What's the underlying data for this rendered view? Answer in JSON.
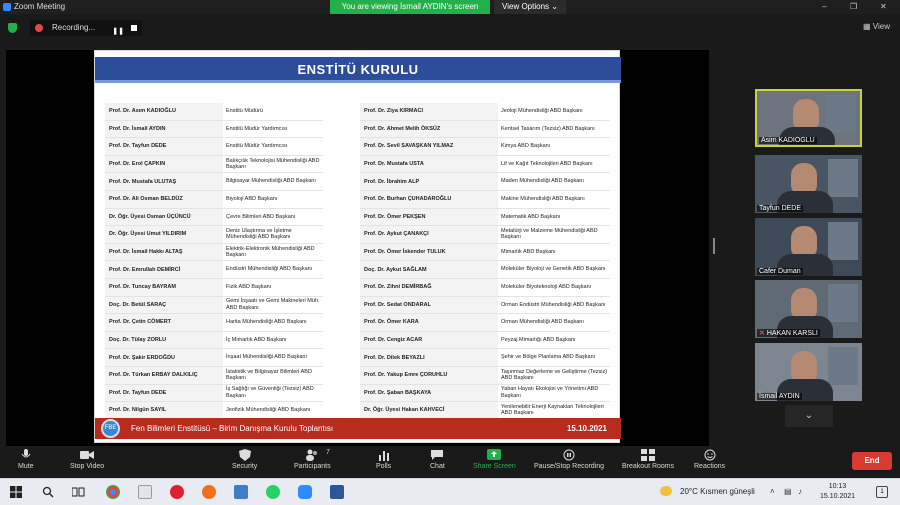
{
  "window": {
    "title": "Zoom Meeting",
    "banner": "You are viewing İsmail AYDIN's screen",
    "view_options": "View Options ⌄",
    "minimize": "–",
    "maximize": "❐",
    "close": "✕"
  },
  "status": {
    "recording_label": "Recording...",
    "pause": "❚❚",
    "view_label": "View"
  },
  "slide": {
    "title": "ENSTİTÜ KURULU",
    "left": [
      {
        "name": "Prof. Dr. Asım KADIOĞLU",
        "role": "Enstitü Müdürü"
      },
      {
        "name": "Prof. Dr. İsmail AYDIN",
        "role": "Enstitü Müdür Yardımcısı"
      },
      {
        "name": "Prof. Dr. Tayfun DEDE",
        "role": "Enstitü Müdür Yardımcısı"
      },
      {
        "name": "Prof. Dr. Erol ÇAPKIN",
        "role": "Balıkçılık Teknolojisi Mühendisliği ABD Başkanı"
      },
      {
        "name": "Prof. Dr. Mustafa ULUTAŞ",
        "role": "Bilgisayar Mühendisliği ABD Başkanı"
      },
      {
        "name": "Prof. Dr. Ali Osman BELDÜZ",
        "role": "Biyoloji ABD Başkanı"
      },
      {
        "name": "Dr. Öğr. Üyesi Osman ÜÇÜNCÜ",
        "role": "Çevre Bilimleri ABD Başkanı"
      },
      {
        "name": "Dr. Öğr. Üyesi Umut YILDIRIM",
        "role": "Deniz Ulaştırma ve İşletme Mühendisliği ABD Başkanı"
      },
      {
        "name": "Prof. Dr. İsmail Hakkı ALTAŞ",
        "role": "Elektrik-Elektronik Mühendisliği ABD Başkanı"
      },
      {
        "name": "Prof. Dr. Emrullah DEMİRCİ",
        "role": "Endüstri Mühendisliği ABD Başkanı"
      },
      {
        "name": "Prof. Dr. Tuncay BAYRAM",
        "role": "Fizik ABD Başkanı"
      },
      {
        "name": "Doç. Dr. Betül SARAÇ",
        "role": "Gemi İnşaatı ve Gemi Makineleri Müh. ABD Başkanı"
      },
      {
        "name": "Prof. Dr. Çetin CÖMERT",
        "role": "Harita Mühendisliği ABD Başkanı"
      },
      {
        "name": "Doç. Dr. Tülay ZORLU",
        "role": "İç Mimarlık ABD Başkanı"
      },
      {
        "name": "Prof. Dr. Şakir ERDOĞDU",
        "role": "İnşaat Mühendisliği ABD Başkanı"
      },
      {
        "name": "Prof. Dr. Türkan ERBAY DALKILIÇ",
        "role": "İstatistik ve Bilgisayar Bilimleri ABD Başkanı"
      },
      {
        "name": "Prof. Dr. Tayfun DEDE",
        "role": "İş Sağlığı ve Güvenliği (Tezsiz) ABD Başkanı"
      },
      {
        "name": "Prof. Dr. Nilgün SAYIL",
        "role": "Jeofizik Mühendisliği ABD Başkanı"
      }
    ],
    "right": [
      {
        "name": "Prof. Dr. Ziya KIRMACI",
        "role": "Jeoloji Mühendisliği ABD Başkanı"
      },
      {
        "name": "Prof. Dr. Ahmet Melih ÖKSÜZ",
        "role": "Kentsel Tasarım (Tezsiz) ABD Başkanı"
      },
      {
        "name": "Prof. Dr. Sevil SAVAŞKAN YILMAZ",
        "role": "Kimya ABD Başkanı"
      },
      {
        "name": "Prof. Dr. Mustafa USTA",
        "role": "Lif ve Kağıt Teknolojileri ABD Başkanı"
      },
      {
        "name": "Prof. Dr. İbrahim ALP",
        "role": "Maden Mühendisliği ABD Başkanı"
      },
      {
        "name": "Prof. Dr. Burhan ÇUHADAROĞLU",
        "role": "Makine Mühendisliği ABD Başkanı"
      },
      {
        "name": "Prof. Dr. Ömer PEKŞEN",
        "role": "Matematik ABD Başkanı"
      },
      {
        "name": "Prof. Dr. Aykut ÇANAKÇI",
        "role": "Metalürji ve Malzeme Mühendisliği ABD Başkanı"
      },
      {
        "name": "Prof. Dr. Ömer İskender TULUK",
        "role": "Mimarlık ABD Başkanı"
      },
      {
        "name": "Doç. Dr. Aykut SAĞLAM",
        "role": "Moleküler Biyoloji ve Genetik ABD Başkanı"
      },
      {
        "name": "Prof. Dr. Zihni DEMİRBAĞ",
        "role": "Moleküler Biyoteknoloji ABD Başkanı"
      },
      {
        "name": "Prof. Dr. Sedat ONDARAL",
        "role": "Orman Endüstri Mühendisliği ABD Başkanı"
      },
      {
        "name": "Prof. Dr. Ömer KARA",
        "role": "Orman Mühendisliği ABD Başkanı"
      },
      {
        "name": "Prof. Dr. Cengiz ACAR",
        "role": "Peyzaj Mimarlığı ABD Başkanı"
      },
      {
        "name": "Prof. Dr. Dilek BEYAZLI",
        "role": "Şehir ve Bölge Planlama ABD Başkanı"
      },
      {
        "name": "Prof. Dr. Yakup Emre ÇORUHLU",
        "role": "Taşınmaz Değerleme ve Geliştirme (Tezsiz) ABD Başkanı"
      },
      {
        "name": "Prof. Dr. Şaban BAŞKAYA",
        "role": "Yaban Hayatı Ekolojisi ve Yönetimi ABD Başkanı"
      },
      {
        "name": "Dr. Öğr. Üyesi Hakan KAHVECİ",
        "role": "Yenilenebilir Enerji Kaynakları Teknolojileri ABD Başkanı"
      }
    ],
    "footer_text": "Fen Bilimleri Enstitüsü – Birim Danışma Kurulu Toplantısı",
    "footer_date": "15.10.2021",
    "logo_text": "FBE"
  },
  "participants": [
    {
      "name": "Asim KADIOGLU",
      "muted": false,
      "active": true
    },
    {
      "name": "Tayfun DEDE",
      "muted": false,
      "active": false
    },
    {
      "name": "Cafer Duman",
      "muted": false,
      "active": false
    },
    {
      "name": "HAKAN KARSLI",
      "muted": true,
      "active": false
    },
    {
      "name": "İsmail AYDIN",
      "muted": false,
      "active": false
    }
  ],
  "participants_scroll": "⌄",
  "toolbar": {
    "mute": "Mute",
    "stop_video": "Stop Video",
    "security": "Security",
    "participants": "Participants",
    "participants_count": "7",
    "polls": "Polls",
    "chat": "Chat",
    "share_screen": "Share Screen",
    "recording": "Pause/Stop Recording",
    "breakout": "Breakout Rooms",
    "reactions": "Reactions",
    "end": "End"
  },
  "taskbar": {
    "weather": "20°C  Kısmen güneşli",
    "time": "10:13",
    "date": "15.10.2021",
    "notifications": "1"
  },
  "colors": {
    "accent_green": "#23b04a",
    "slide_blue": "#2b4d9a",
    "slide_red": "#b82b1f",
    "end_red": "#d93a32",
    "active_yellow": "#c8d43a"
  }
}
